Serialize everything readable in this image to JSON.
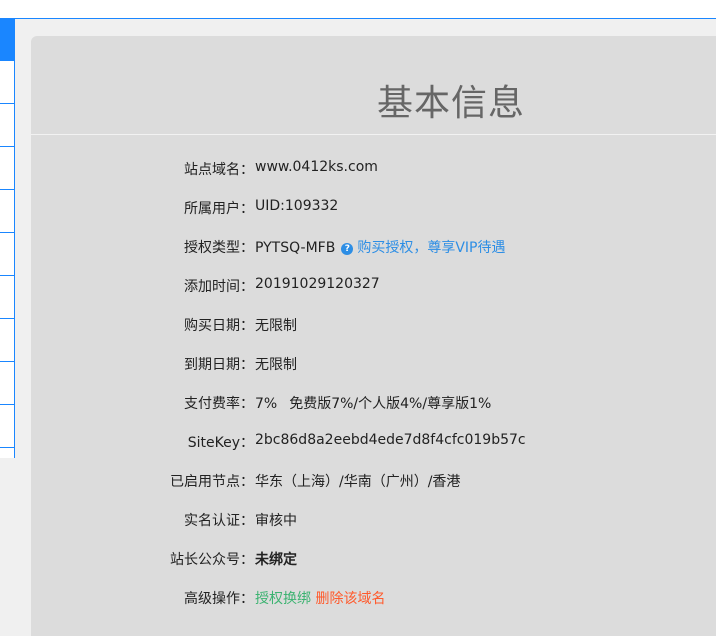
{
  "panel": {
    "title": "基本信息"
  },
  "info": {
    "domain_label": "站点域名：",
    "domain_value": "www.0412ks.com",
    "user_label": "所属用户：",
    "user_value": "UID:109332",
    "license_label": "授权类型：",
    "license_value": "PYTSQ-MFB",
    "license_link": "购买授权，尊享VIP待遇",
    "added_label": "添加时间：",
    "added_value": "20191029120327",
    "buy_label": "购买日期：",
    "buy_value": "无限制",
    "expire_label": "到期日期：",
    "expire_value": "无限制",
    "fee_label": "支付费率：",
    "fee_value": "7%",
    "fee_detail": "免费版7%/个人版4%/尊享版1%",
    "sitekey_label": "SiteKey：",
    "sitekey_value": "2bc86d8a2eebd4ede7d8f4cfc019b57c",
    "nodes_label": "已启用节点：",
    "nodes_value": "华东（上海）/华南（广州）/香港",
    "realname_label": "实名认证：",
    "realname_value": "审核中",
    "wechat_label": "站长公众号：",
    "wechat_value": "未绑定",
    "advanced_label": "高级操作：",
    "advanced_rebind": "授权换绑",
    "advanced_delete": "删除该域名"
  },
  "colors": {
    "link": "#2d8ee5",
    "success": "#3cb371",
    "danger": "#ff5a2c",
    "accent": "#1a86ff"
  }
}
